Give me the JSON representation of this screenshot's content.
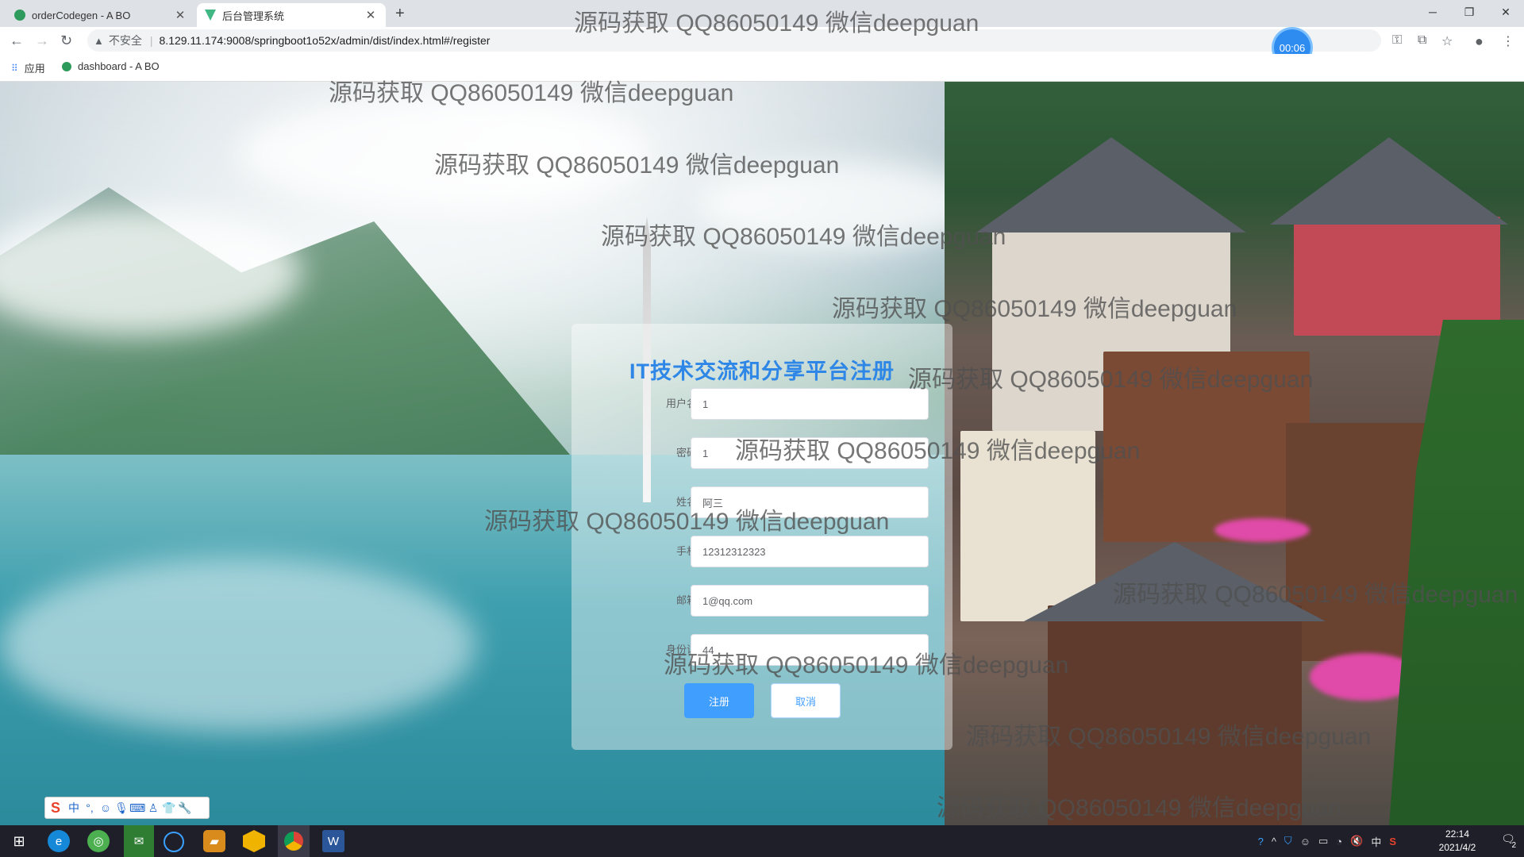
{
  "browser": {
    "tabs": [
      {
        "title": "orderCodegen - A BO",
        "favicon_color": "#2e9a5c"
      },
      {
        "title": "后台管理系统",
        "favicon_color": "#41b883"
      }
    ],
    "url": "8.129.11.174:9008/springboot1o52x/admin/dist/index.html#/register",
    "insecure_label": "不安全",
    "timer": "00:06",
    "bookmarks": {
      "apps": "应用",
      "dashboard": "dashboard - A BO"
    }
  },
  "form": {
    "title": "IT技术交流和分享平台注册",
    "fields": [
      {
        "label": "用户名",
        "value": "1"
      },
      {
        "label": "密码",
        "value": "1"
      },
      {
        "label": "姓名",
        "value": "阿三"
      },
      {
        "label": "手机",
        "value": "12312312323"
      },
      {
        "label": "邮箱",
        "value": "1@qq.com"
      },
      {
        "label": "身份证",
        "value": "44"
      }
    ],
    "register_button": "注册",
    "cancel_button": "取消"
  },
  "watermark_text": "源码获取 QQ86050149 微信deepguan",
  "ime": {
    "logo": "S",
    "mode": "中"
  },
  "taskbar": {
    "time": "22:14",
    "date": "2021/4/2",
    "ime_indicator": "中",
    "notifications": "2"
  },
  "colors": {
    "accent": "#409eff",
    "title": "#2e86e6"
  }
}
